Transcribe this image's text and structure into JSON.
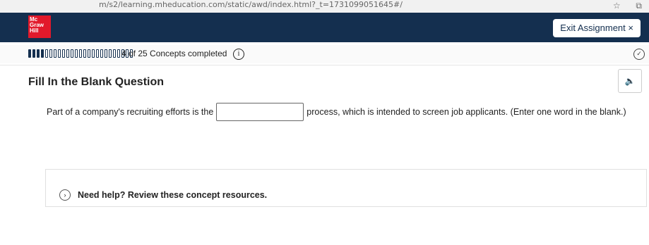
{
  "browser": {
    "url": "m/s2/learning.mheducation.com/static/awd/index.html?_t=1731099051645#/",
    "star_icon": "star-icon",
    "copy_icon": "copy-icon"
  },
  "header": {
    "logo_lines": [
      "Mc",
      "Graw",
      "Hill"
    ],
    "exit_label": "Exit Assignment",
    "exit_icon": "×"
  },
  "progress": {
    "completed": 4,
    "total": 25,
    "text": "4 of 25 Concepts completed",
    "info_icon": "i"
  },
  "question": {
    "title": "Fill In the Blank Question",
    "text_before": "Part of a company's recruiting efforts is the",
    "text_after": "process, which is intended to screen job applicants. (Enter one word in the blank.)"
  },
  "help": {
    "label": "Need help? Review these concept resources."
  },
  "colors": {
    "header_bg": "#142f4f",
    "logo_bg": "#e2192b"
  }
}
